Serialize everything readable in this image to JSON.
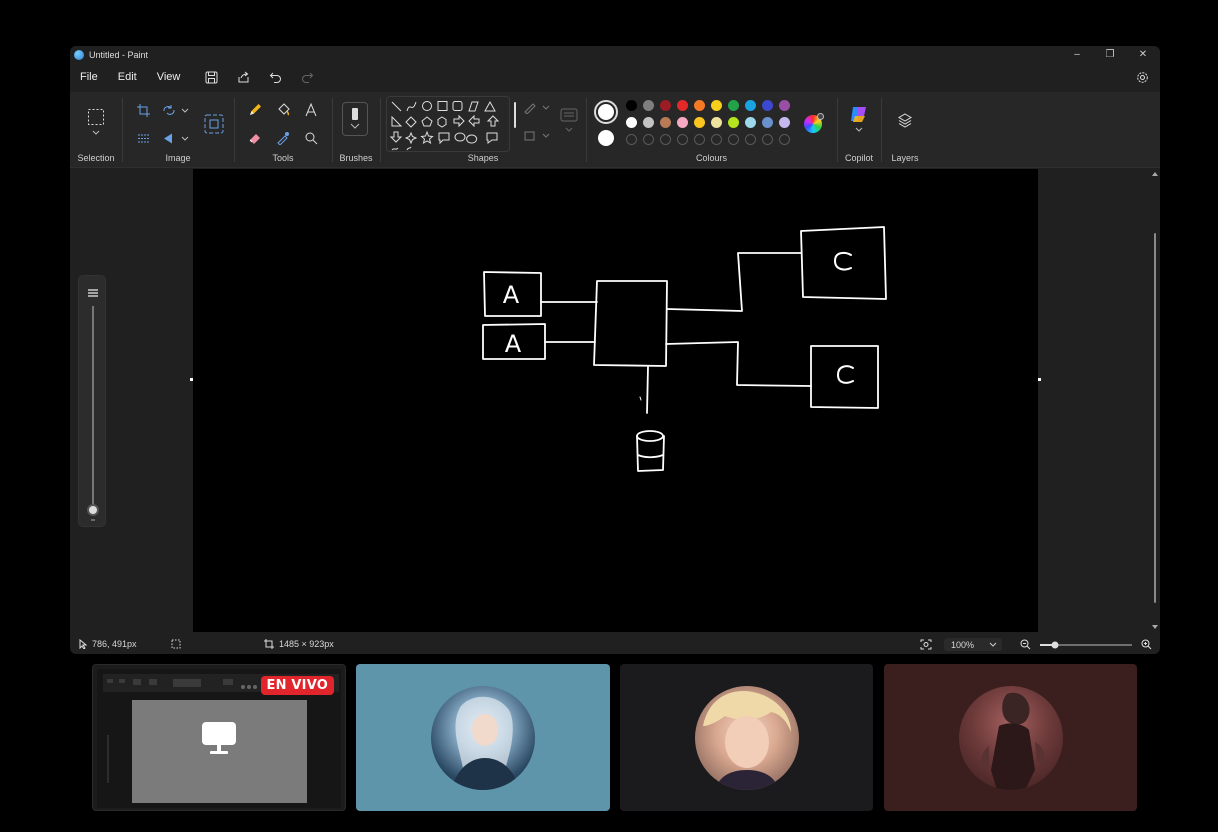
{
  "window": {
    "title": "Untitled - Paint",
    "controls": {
      "minimize": "–",
      "maximize": "❐",
      "close": "✕"
    }
  },
  "menu": {
    "items": [
      "File",
      "Edit",
      "View"
    ]
  },
  "ribbon": {
    "groups": {
      "selection": "Selection",
      "image": "Image",
      "tools": "Tools",
      "brushes": "Brushes",
      "shapes": "Shapes",
      "colours": "Colours",
      "copilot": "Copilot",
      "layers": "Layers"
    },
    "palette_row1": [
      "#000000",
      "#7f7f7f",
      "#9c1c23",
      "#e4292b",
      "#f47a25",
      "#f6cf1c",
      "#22a34a",
      "#1aa3e2",
      "#3d48d0",
      "#9a4ea6"
    ],
    "palette_row2": [
      "#ffffff",
      "#c3c3c3",
      "#b97a57",
      "#f7a9c4",
      "#fbc51f",
      "#eee39e",
      "#b4e41e",
      "#9ad8ea",
      "#6a91cc",
      "#c6b8ec"
    ],
    "primary_color": "#ffffff",
    "secondary_color": "#ffffff"
  },
  "canvas": {
    "box_labels": {
      "a1": "A",
      "a2": "A",
      "c1": "C",
      "c2": "C"
    }
  },
  "status": {
    "cursor_pos": "786, 491px",
    "canvas_size": "1485 × 923px",
    "zoom": "100%"
  },
  "participants": {
    "live_badge": "EN VIVO",
    "tile_colors": [
      "#1c1c1c",
      "#5e95ab",
      "#1b1b1d",
      "#3b1f1f"
    ]
  }
}
